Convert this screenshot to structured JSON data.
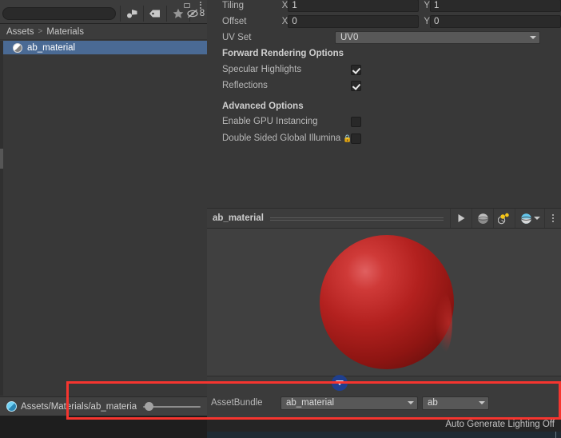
{
  "project_panel": {
    "search": {
      "value": "",
      "placeholder": ""
    },
    "toolbar": {
      "buttons": [
        {
          "name": "create-asset-button",
          "icon": "add-asset-icon",
          "label": ""
        },
        {
          "name": "label-filter-button",
          "icon": "tag-icon",
          "label": ""
        },
        {
          "name": "favorite-filter-button",
          "icon": "star-icon",
          "label": ""
        },
        {
          "name": "hidden-count-button",
          "icon": "eye-off-icon",
          "label": "8"
        }
      ],
      "maximize_label": "",
      "menu_label": ""
    },
    "breadcrumb": {
      "root": "Assets",
      "separator": ">",
      "current": "Materials"
    },
    "assets": [
      {
        "name": "ab_material",
        "icon": "material-sphere-icon",
        "selected": true
      }
    ],
    "status": {
      "icon": "material-sphere-icon",
      "path": "Assets/Materials/ab_materia",
      "zoom_value": 0
    }
  },
  "inspector": {
    "properties": [
      {
        "label": "Tiling",
        "type": "vector2",
        "x_axis": "X",
        "x_value": "1",
        "y_axis": "Y",
        "y_value": "1"
      },
      {
        "label": "Offset",
        "type": "vector2",
        "x_axis": "X",
        "x_value": "0",
        "y_axis": "Y",
        "y_value": "0"
      },
      {
        "label": "UV Set",
        "type": "dropdown",
        "value": "UV0"
      }
    ],
    "sections": [
      {
        "header": "Forward Rendering Options",
        "items": [
          {
            "label": "Specular Highlights",
            "checked": true,
            "locked": false
          },
          {
            "label": "Reflections",
            "checked": true,
            "locked": false
          }
        ]
      },
      {
        "header": "Advanced Options",
        "items": [
          {
            "label": "Enable GPU Instancing",
            "checked": false,
            "locked": false
          },
          {
            "label": "Double Sided Global Illumina",
            "checked": false,
            "locked": true
          }
        ]
      }
    ],
    "preview": {
      "title": "ab_material",
      "toolbar": [
        {
          "name": "play-preview-button",
          "icon": "play-icon"
        },
        {
          "name": "preview-mesh-button",
          "icon": "sphere-icon"
        },
        {
          "name": "preview-lighting-button",
          "icon": "lighting-icon"
        },
        {
          "name": "preview-render-mode-dropdown",
          "icon": "sphere-blue-icon"
        },
        {
          "name": "preview-options-menu",
          "icon": "kebab-menu-icon"
        }
      ],
      "object": "red-sphere"
    },
    "asset_bundle": {
      "label": "AssetBundle",
      "name_value": "ab_material",
      "variant_value": "ab",
      "highlight_color": "#f6352f",
      "badge_icon": "chevron-down-badge-icon"
    },
    "lighting_status": "Auto Generate Lighting Off"
  },
  "bottom_strip": {
    "partial_text": ""
  }
}
